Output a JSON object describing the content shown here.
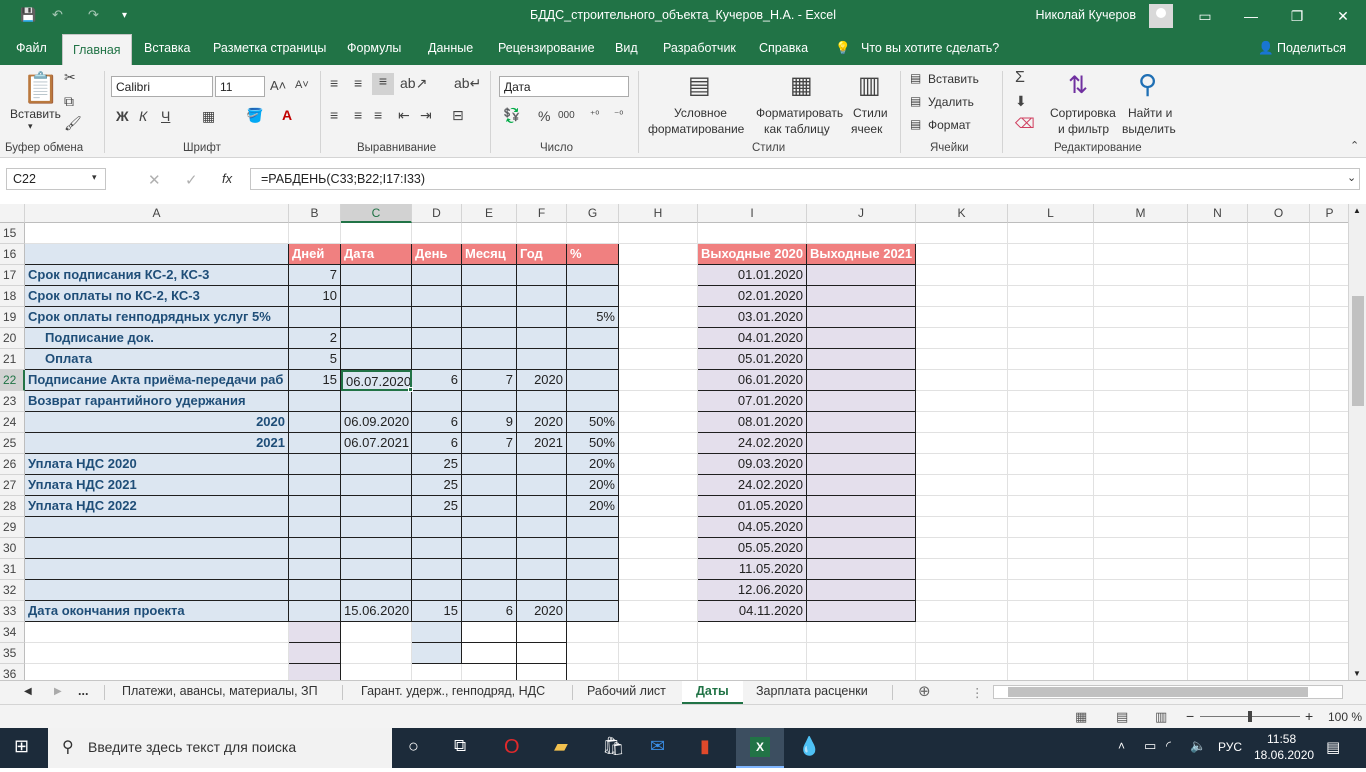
{
  "window": {
    "title": "БДДС_строительного_объекта_Кучеров_Н.А.  -  Excel",
    "user": "Николай Кучеров",
    "qa_save": "💾",
    "qa_undo": "↶",
    "qa_redo": "↷"
  },
  "tabs": [
    "Файл",
    "Главная",
    "Вставка",
    "Разметка страницы",
    "Формулы",
    "Данные",
    "Рецензирование",
    "Вид",
    "Разработчик",
    "Справка"
  ],
  "tell_me": "Что вы хотите сделать?",
  "share": "Поделиться",
  "ribbon": {
    "paste": "Вставить",
    "clipboard": "Буфер обмена",
    "font_name": "Calibri",
    "font_size": "11",
    "font_group": "Шрифт",
    "align_group": "Выравнивание",
    "number_format": "Дата",
    "number_group": "Число",
    "cond_format_1": "Условное",
    "cond_format_2": "форматирование",
    "format_table_1": "Форматировать",
    "format_table_2": "как таблицу",
    "cell_styles_1": "Стили",
    "cell_styles_2": "ячеек",
    "styles_group": "Стили",
    "insert": "Вставить",
    "delete": "Удалить",
    "format": "Формат",
    "cells_group": "Ячейки",
    "sort_1": "Сортировка",
    "sort_2": "и фильтр",
    "find_1": "Найти и",
    "find_2": "выделить",
    "editing_group": "Редактирование"
  },
  "formula_bar": {
    "name_box": "C22",
    "formula": "=РАБДЕНЬ(C33;B22;I17:I33)",
    "fx": "fx"
  },
  "columns": [
    "A",
    "B",
    "C",
    "D",
    "E",
    "F",
    "G",
    "H",
    "I",
    "J",
    "K",
    "L",
    "M",
    "N",
    "O",
    "P"
  ],
  "rows": [
    "15",
    "16",
    "17",
    "18",
    "19",
    "20",
    "21",
    "22",
    "23",
    "24",
    "25",
    "26",
    "27",
    "28",
    "29",
    "30",
    "31",
    "32",
    "33",
    "34",
    "35",
    "36"
  ],
  "header_row": {
    "B": "Дней",
    "C": "Дата",
    "D": "День",
    "E": "Месяц",
    "F": "Год",
    "G": "%",
    "I": "Выходные 2020",
    "J": "Выходные 2021"
  },
  "table": [
    {
      "A": "Срок подписания КС-2, КС-3",
      "B": "7",
      "C": "",
      "D": "",
      "E": "",
      "F": "",
      "G": ""
    },
    {
      "A": "Срок оплаты по КС-2, КС-3",
      "B": "10",
      "C": "",
      "D": "",
      "E": "",
      "F": "",
      "G": ""
    },
    {
      "A": "Срок оплаты генподрядных услуг 5%",
      "B": "",
      "C": "",
      "D": "",
      "E": "",
      "F": "",
      "G": "5%"
    },
    {
      "A": "Подписание док.",
      "B": "2",
      "C": "",
      "D": "",
      "E": "",
      "F": "",
      "G": ""
    },
    {
      "A": "Оплата",
      "B": "5",
      "C": "",
      "D": "",
      "E": "",
      "F": "",
      "G": ""
    },
    {
      "A": "Подписание Акта приёма-передачи раб",
      "B": "15",
      "C": "06.07.2020",
      "D": "6",
      "E": "7",
      "F": "2020",
      "G": ""
    },
    {
      "A": "Возврат гарантийного удержания",
      "B": "",
      "C": "",
      "D": "",
      "E": "",
      "F": "",
      "G": ""
    },
    {
      "A": "2020",
      "B": "",
      "C": "06.09.2020",
      "D": "6",
      "E": "9",
      "F": "2020",
      "G": "50%"
    },
    {
      "A": "2021",
      "B": "",
      "C": "06.07.2021",
      "D": "6",
      "E": "7",
      "F": "2021",
      "G": "50%"
    },
    {
      "A": "Уплата НДС 2020",
      "B": "",
      "C": "",
      "D": "25",
      "E": "",
      "F": "",
      "G": "20%"
    },
    {
      "A": "Уплата НДС 2021",
      "B": "",
      "C": "",
      "D": "25",
      "E": "",
      "F": "",
      "G": "20%"
    },
    {
      "A": "Уплата НДС 2022",
      "B": "",
      "C": "",
      "D": "25",
      "E": "",
      "F": "",
      "G": "20%"
    },
    {
      "A": "",
      "B": "",
      "C": "",
      "D": "",
      "E": "",
      "F": "",
      "G": ""
    },
    {
      "A": "",
      "B": "",
      "C": "",
      "D": "",
      "E": "",
      "F": "",
      "G": ""
    },
    {
      "A": "",
      "B": "",
      "C": "",
      "D": "",
      "E": "",
      "F": "",
      "G": ""
    },
    {
      "A": "",
      "B": "",
      "C": "",
      "D": "",
      "E": "",
      "F": "",
      "G": ""
    },
    {
      "A": "Дата окончания проекта",
      "B": "",
      "C": "15.06.2020",
      "D": "15",
      "E": "6",
      "F": "2020",
      "G": ""
    }
  ],
  "holidays_2020": [
    "01.01.2020",
    "02.01.2020",
    "03.01.2020",
    "04.01.2020",
    "05.01.2020",
    "06.01.2020",
    "07.01.2020",
    "08.01.2020",
    "24.02.2020",
    "09.03.2020",
    "24.02.2020",
    "01.05.2020",
    "04.05.2020",
    "05.05.2020",
    "11.05.2020",
    "12.06.2020",
    "04.11.2020"
  ],
  "sheet_tabs": [
    "...",
    "Платежи, авансы, материалы, ЗП",
    "Гарант. удерж., генподряд, НДС",
    "Рабочий лист",
    "Даты",
    "Зарплата расценки"
  ],
  "active_sheet": "Даты",
  "status": {
    "zoom": "100 %"
  },
  "taskbar": {
    "search_placeholder": "Введите здесь текст для поиска",
    "lang": "РУС",
    "time": "11:58",
    "date": "18.06.2020"
  },
  "colors": {
    "excel_green": "#217346",
    "header_red": "#f08080",
    "table_blue": "#dce6f1",
    "holiday_lavender": "#e4dfec"
  }
}
